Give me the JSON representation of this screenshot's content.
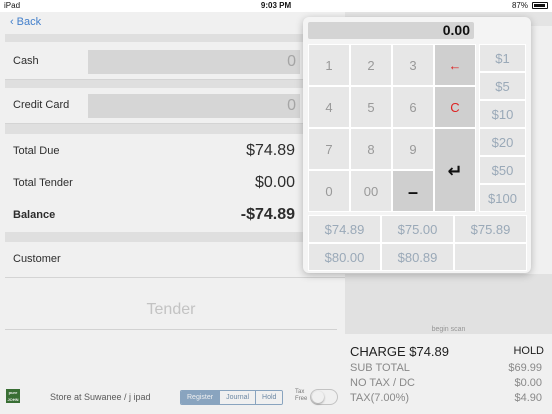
{
  "status_bar": {
    "device": "iPad",
    "time": "9:03 PM",
    "battery": "87%"
  },
  "nav": {
    "back_label": "Back"
  },
  "payments": {
    "cash": {
      "label": "Cash",
      "value": "0"
    },
    "credit_card": {
      "label": "Credit Card",
      "value": "0"
    }
  },
  "totals": {
    "total_due": {
      "label": "Total Due",
      "value": "$74.89"
    },
    "total_tender": {
      "label": "Total Tender",
      "value": "$0.00"
    },
    "balance": {
      "label": "Balance",
      "value": "-$74.89"
    }
  },
  "customer": {
    "label": "Customer"
  },
  "tender_button": "Tender",
  "footer": {
    "logo_top": "pure",
    "logo_bottom": "JOHN",
    "store": "Store at Suwanee / j ipad",
    "segments": [
      "Register",
      "Journal",
      "Hold"
    ],
    "active_segment": "Register",
    "tax_free_label_1": "Tax",
    "tax_free_label_2": "Free"
  },
  "keypad": {
    "display": "0.00",
    "digits": [
      "1",
      "2",
      "3",
      "4",
      "5",
      "6",
      "7",
      "8",
      "9",
      "0",
      "00"
    ],
    "backspace": "←",
    "clear": "C",
    "minus": "–",
    "enter": "↵",
    "cash_amounts": [
      "$1",
      "$5",
      "$10",
      "$20",
      "$50",
      "$100"
    ],
    "quick_amounts": [
      "$74.89",
      "$75.00",
      "$75.89",
      "$80.00",
      "$80.89"
    ]
  },
  "summary": {
    "begin_scan": "begin scan",
    "charge": "CHARGE $74.89",
    "hold": "HOLD",
    "rows": [
      {
        "label": "SUB TOTAL",
        "value": "$69.99"
      },
      {
        "label": "NO TAX / DC",
        "value": "$0.00"
      },
      {
        "label": "TAX(7.00%)",
        "value": "$4.90"
      }
    ]
  }
}
